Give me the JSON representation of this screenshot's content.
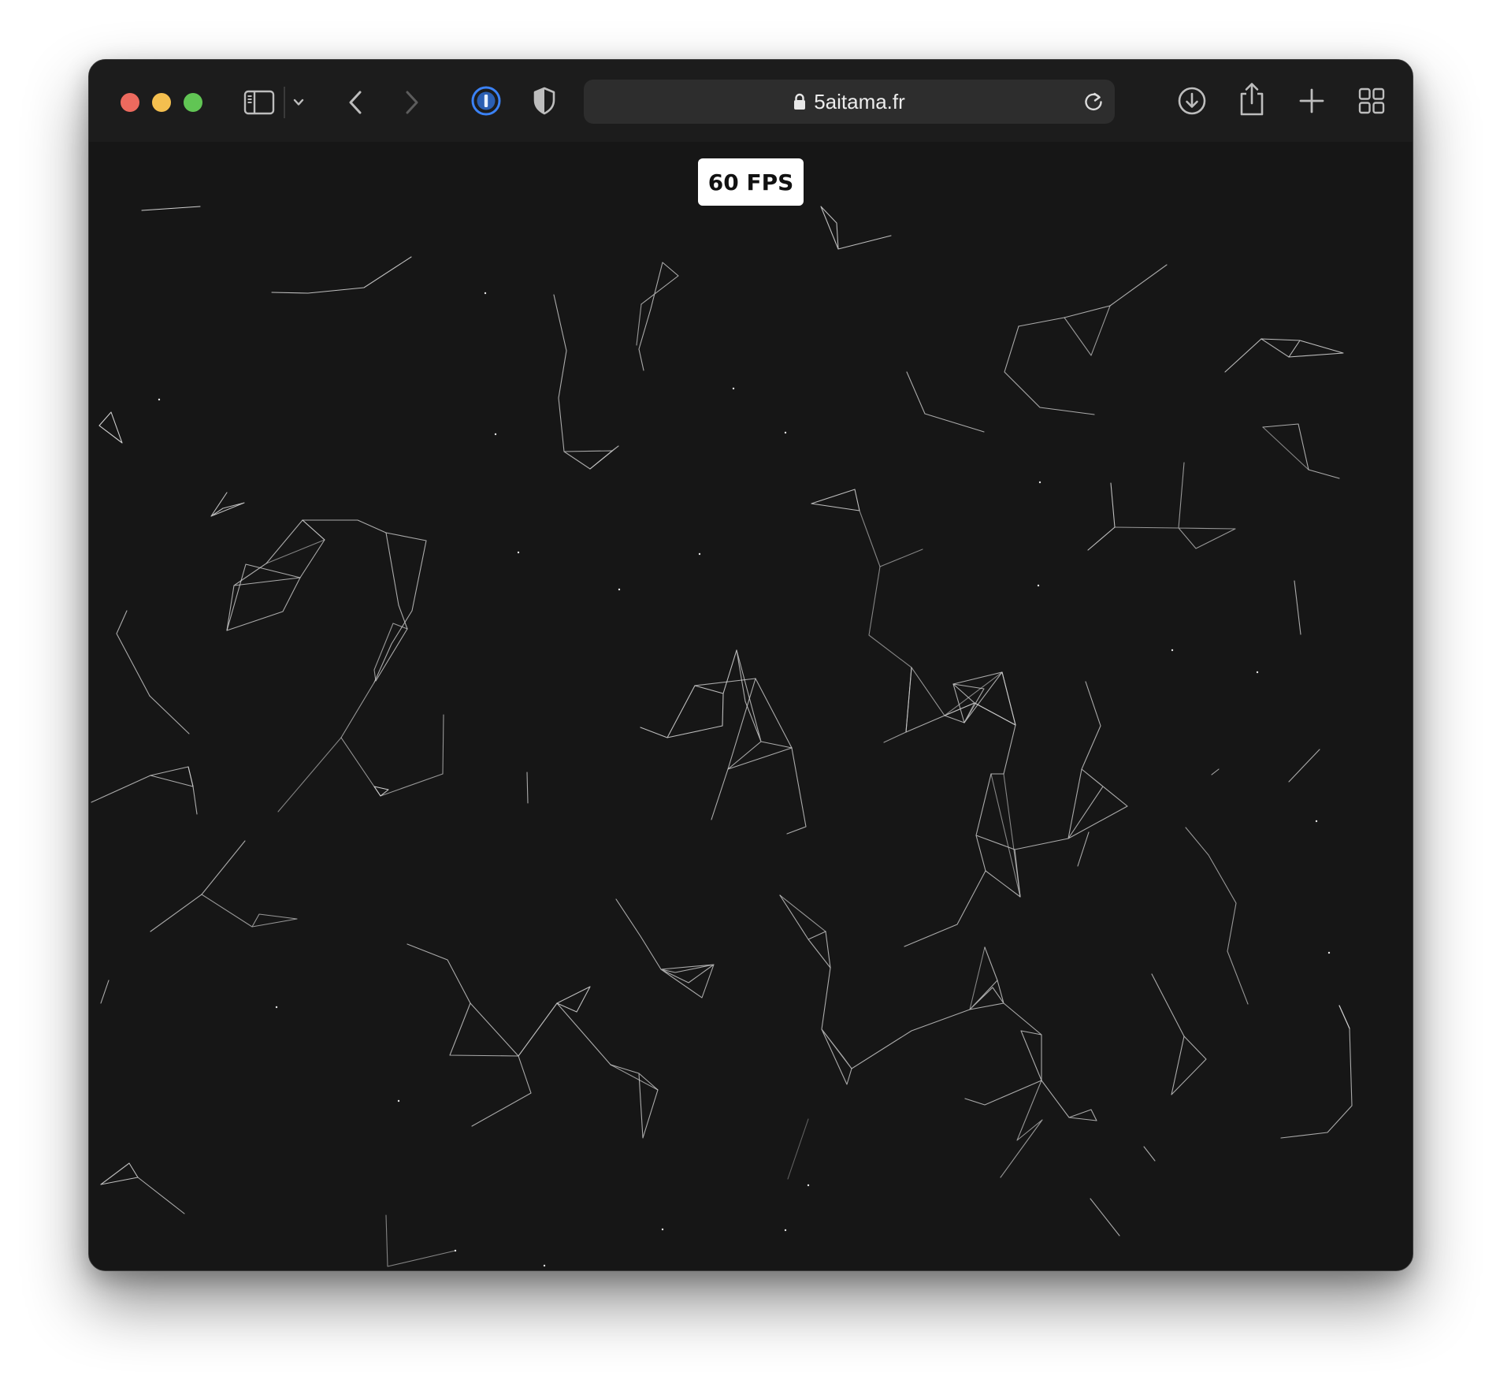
{
  "browser": {
    "url_text": "5aitama.fr",
    "icons": {
      "sidebar": "sidebar-icon",
      "sidebar_menu": "chevron-down-icon",
      "back": "back-arrow-icon",
      "forward": "forward-arrow-icon",
      "password_manager": "1password-icon",
      "privacy": "shield-icon",
      "lock": "lock-icon",
      "reload": "reload-icon",
      "downloads": "download-icon",
      "share": "share-icon",
      "new_tab": "plus-icon",
      "tab_overview": "tab-overview-icon"
    },
    "colors": {
      "close": "#ec6a5e",
      "minimize": "#f4bf4f",
      "zoom": "#61c554",
      "password_manager_accent": "#3b82f6",
      "page_background": "#161616",
      "lines": "#cfcfcf"
    }
  },
  "page": {
    "fps_label": "60 FPS"
  }
}
